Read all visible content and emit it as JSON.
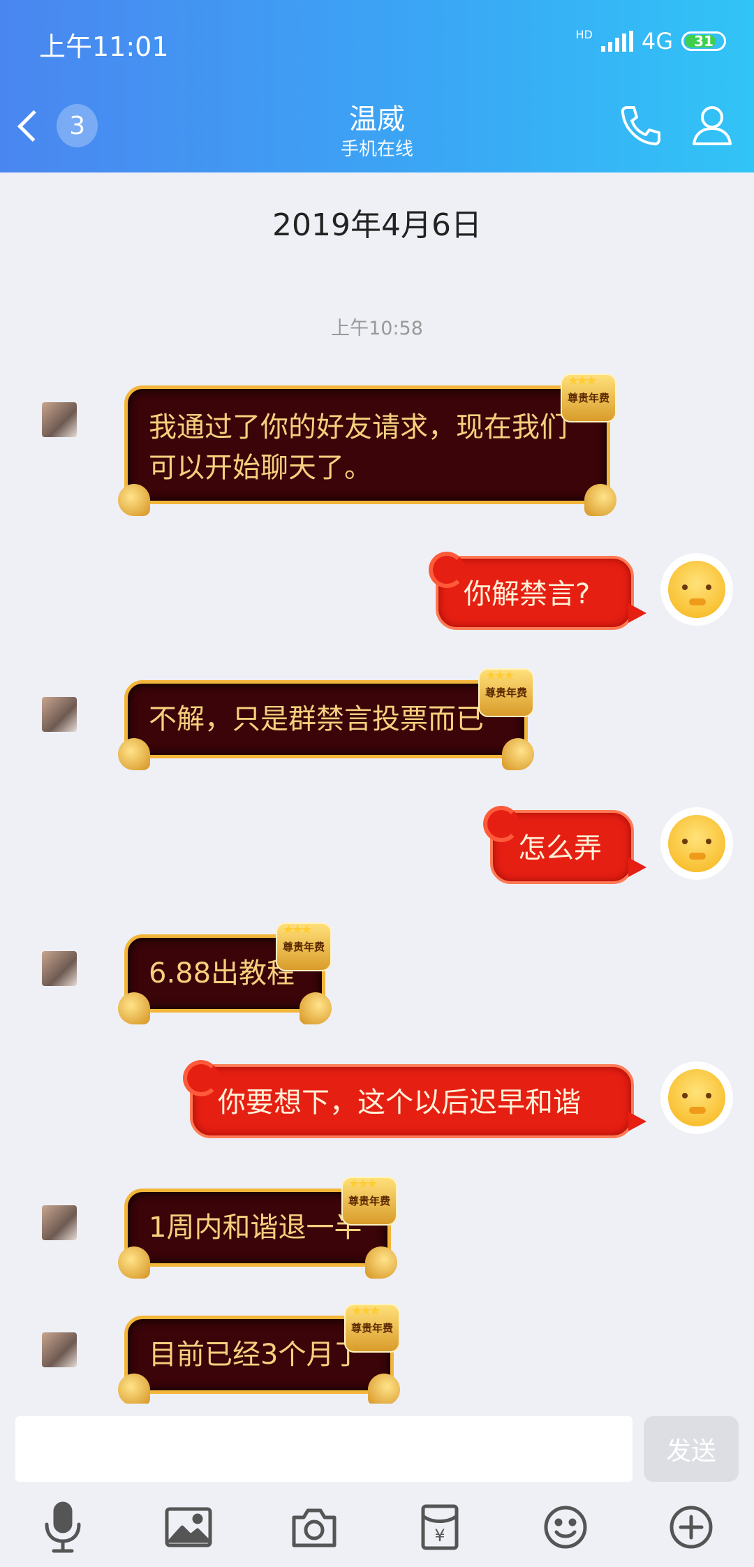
{
  "status_bar": {
    "time": "上午11:01",
    "network_hd": "HD",
    "network": "4G",
    "battery": "31"
  },
  "header": {
    "back_badge": "3",
    "contact_name": "温威",
    "contact_status": "手机在线",
    "icons": [
      "phone-icon",
      "profile-icon"
    ]
  },
  "chat": {
    "date": "2019年4月6日",
    "time": "上午10:58",
    "vip_badge": "尊贵年费",
    "messages": [
      {
        "side": "in",
        "text": "我通过了你的好友请求，现在我们可以开始聊天了。"
      },
      {
        "side": "out",
        "text": "你解禁言?"
      },
      {
        "side": "in",
        "text": "不解，只是群禁言投票而已"
      },
      {
        "side": "out",
        "text": "怎么弄"
      },
      {
        "side": "in",
        "text": "6.88出教程"
      },
      {
        "side": "out",
        "text": "你要想下，这个以后迟早和谐"
      },
      {
        "side": "in",
        "text": "1周内和谐退一半"
      },
      {
        "side": "in",
        "text": "目前已经3个月了"
      }
    ]
  },
  "input": {
    "value": "",
    "send_label": "发送"
  },
  "toolbar": {
    "items": [
      "microphone-icon",
      "image-icon",
      "camera-icon",
      "red-packet-icon",
      "emoji-icon",
      "plus-icon"
    ]
  },
  "colors": {
    "header_start": "#4a86f0",
    "header_end": "#31c4f6",
    "incoming_bubble": "#3a0408",
    "incoming_border": "#f3b63a",
    "outgoing_bubble": "#e61f13",
    "background": "#eef0f6"
  }
}
